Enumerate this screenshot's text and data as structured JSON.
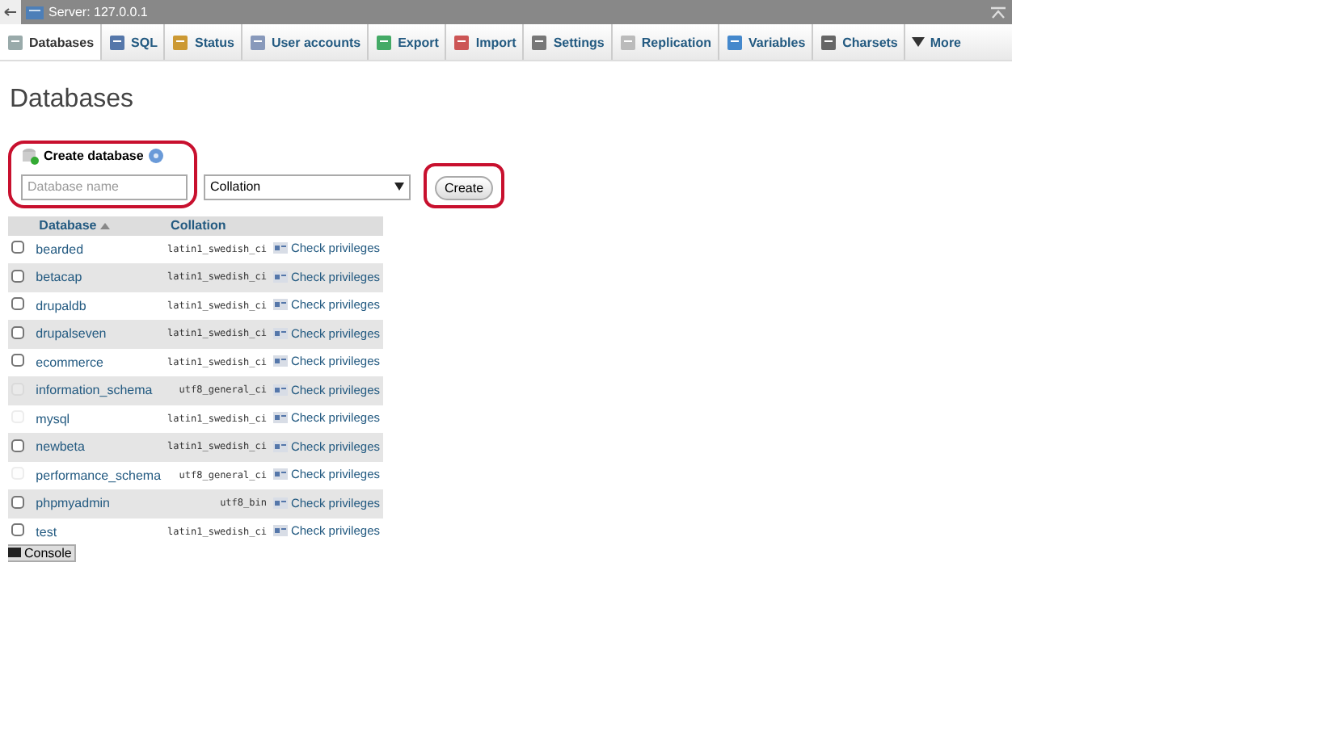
{
  "window": {
    "title": "Server: 127.0.0.1"
  },
  "tabs": [
    {
      "label": "Databases",
      "selected": true
    },
    {
      "label": "SQL",
      "selected": false
    },
    {
      "label": "Status",
      "selected": false
    },
    {
      "label": "User accounts",
      "selected": false
    },
    {
      "label": "Export",
      "selected": false
    },
    {
      "label": "Import",
      "selected": false
    },
    {
      "label": "Settings",
      "selected": false
    },
    {
      "label": "Replication",
      "selected": false
    },
    {
      "label": "Variables",
      "selected": false
    },
    {
      "label": "Charsets",
      "selected": false
    },
    {
      "label": "More",
      "selected": false
    }
  ],
  "heading": "Databases",
  "create_database": {
    "label": "Create database",
    "name_field": {
      "placeholder": "Database name"
    },
    "collation_select": {
      "value": "Collation"
    },
    "button": "Create"
  },
  "table": {
    "columns": [
      "Database",
      "Collation"
    ],
    "rows": [
      {
        "name": "bearded",
        "collation": "latin1_swedish_ci",
        "action": "Check privileges",
        "disabled": false
      },
      {
        "name": "betacap",
        "collation": "latin1_swedish_ci",
        "action": "Check privileges",
        "disabled": false
      },
      {
        "name": "drupaldb",
        "collation": "latin1_swedish_ci",
        "action": "Check privileges",
        "disabled": false
      },
      {
        "name": "drupalseven",
        "collation": "latin1_swedish_ci",
        "action": "Check privileges",
        "disabled": false
      },
      {
        "name": "ecommerce",
        "collation": "latin1_swedish_ci",
        "action": "Check privileges",
        "disabled": false
      },
      {
        "name": "information_schema",
        "collation": "utf8_general_ci",
        "action": "Check privileges",
        "disabled": true
      },
      {
        "name": "mysql",
        "collation": "latin1_swedish_ci",
        "action": "Check privileges",
        "disabled": true
      },
      {
        "name": "newbeta",
        "collation": "latin1_swedish_ci",
        "action": "Check privileges",
        "disabled": false
      },
      {
        "name": "performance_schema",
        "collation": "utf8_general_ci",
        "action": "Check privileges",
        "disabled": true
      },
      {
        "name": "phpmyadmin",
        "collation": "utf8_bin",
        "action": "Check privileges",
        "disabled": false
      },
      {
        "name": "test",
        "collation": "latin1_swedish_ci",
        "action": "Check privileges",
        "disabled": false
      }
    ]
  },
  "console": "Console"
}
